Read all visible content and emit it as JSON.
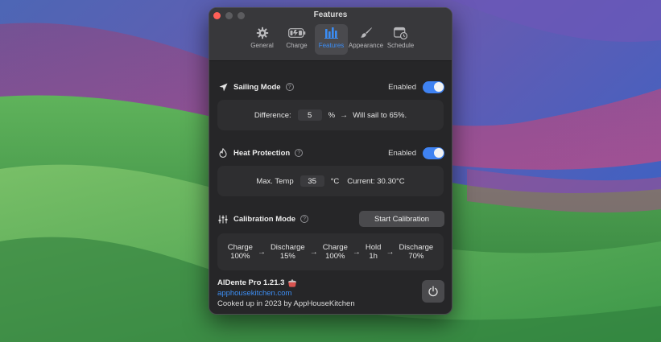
{
  "window": {
    "title": "Features"
  },
  "tabs": [
    {
      "label": "General",
      "icon": "gear-icon"
    },
    {
      "label": "Charge",
      "icon": "battery-icon"
    },
    {
      "label": "Features",
      "icon": "bar-chart-icon",
      "active": true
    },
    {
      "label": "Appearance",
      "icon": "paintbrush-icon"
    },
    {
      "label": "Schedule",
      "icon": "calendar-clock-icon"
    }
  ],
  "sailing": {
    "title": "Sailing Mode",
    "status": "Enabled",
    "enabled": true,
    "difference_label": "Difference:",
    "difference_value": "5",
    "unit": "%",
    "arrow": "→",
    "result": "Will sail to 65%."
  },
  "heat": {
    "title": "Heat Protection",
    "status": "Enabled",
    "enabled": true,
    "max_label": "Max. Temp",
    "max_value": "35",
    "unit": "°C",
    "current": "Current: 30.30°C"
  },
  "calibration": {
    "title": "Calibration Mode",
    "button": "Start Calibration",
    "steps": [
      {
        "line1": "Charge",
        "line2": "100%"
      },
      {
        "line1": "Discharge",
        "line2": "15%"
      },
      {
        "line1": "Charge",
        "line2": "100%"
      },
      {
        "line1": "Hold",
        "line2": "1h"
      },
      {
        "line1": "Discharge",
        "line2": "70%"
      }
    ],
    "arrow": "→"
  },
  "footer": {
    "app_name": "AlDente Pro 1.21.3",
    "link": "apphousekitchen.com",
    "credit": "Cooked up in 2023 by AppHouseKitchen"
  },
  "help_glyph": "?",
  "colors": {
    "accent": "#3f82f1",
    "link": "#3d8ef3",
    "window_bg": "#262628"
  }
}
